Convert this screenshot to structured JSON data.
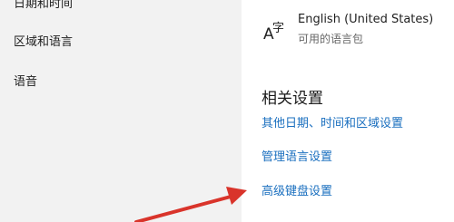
{
  "sidebar": {
    "items": [
      {
        "label": "日期和时间"
      },
      {
        "label": "区域和语言"
      },
      {
        "label": "语音"
      }
    ]
  },
  "main": {
    "language": {
      "icon": "language-icon",
      "icon_glyph_a": "A",
      "icon_glyph_zi": "字",
      "name": "English (United States)",
      "subtitle": "可用的语言包"
    },
    "related": {
      "title": "相关设置",
      "links": [
        {
          "label": "其他日期、时间和区域设置"
        },
        {
          "label": "管理语言设置"
        },
        {
          "label": "高级键盘设置"
        }
      ]
    }
  },
  "colors": {
    "link": "#1a6fbf",
    "sidebar_bg": "#f2f2f2",
    "annotation_arrow": "#d9342b"
  }
}
